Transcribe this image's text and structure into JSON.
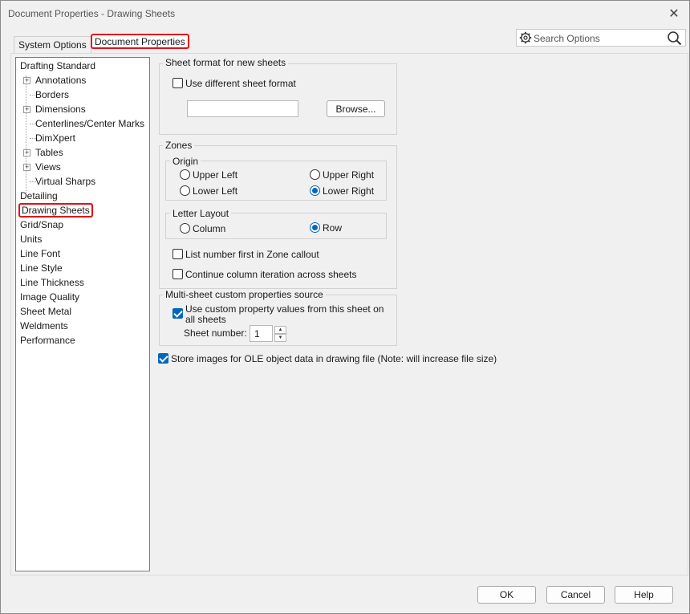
{
  "window": {
    "title": "Document Properties - Drawing Sheets"
  },
  "tabs": {
    "system": "System Options",
    "document": "Document Properties"
  },
  "search": {
    "placeholder": "Search Options"
  },
  "tree": {
    "items": [
      {
        "label": "Drafting Standard"
      },
      {
        "label": "Annotations"
      },
      {
        "label": "Borders"
      },
      {
        "label": "Dimensions"
      },
      {
        "label": "Centerlines/Center Marks"
      },
      {
        "label": "DimXpert"
      },
      {
        "label": "Tables"
      },
      {
        "label": "Views"
      },
      {
        "label": "Virtual Sharps"
      },
      {
        "label": "Detailing"
      },
      {
        "label": "Drawing Sheets"
      },
      {
        "label": "Grid/Snap"
      },
      {
        "label": "Units"
      },
      {
        "label": "Line Font"
      },
      {
        "label": "Line Style"
      },
      {
        "label": "Line Thickness"
      },
      {
        "label": "Image Quality"
      },
      {
        "label": "Sheet Metal"
      },
      {
        "label": "Weldments"
      },
      {
        "label": "Performance"
      }
    ],
    "selected": "Drawing Sheets"
  },
  "sheet_format": {
    "title": "Sheet format for new sheets",
    "use_different_label": "Use different sheet format",
    "use_different_checked": false,
    "path_value": "",
    "browse_label": "Browse..."
  },
  "zones": {
    "title": "Zones",
    "origin": {
      "title": "Origin",
      "upper_left": "Upper Left",
      "upper_right": "Upper Right",
      "lower_left": "Lower Left",
      "lower_right": "Lower Right",
      "selected": "Lower Right"
    },
    "letter_layout": {
      "title": "Letter Layout",
      "column": "Column",
      "row": "Row",
      "selected": "Row"
    },
    "list_number_first": "List number first in Zone callout",
    "list_number_first_checked": false,
    "continue_iteration": "Continue column iteration across sheets",
    "continue_iteration_checked": false
  },
  "multi_sheet": {
    "title": "Multi-sheet custom properties source",
    "use_custom_line1": "Use custom property values from this sheet on",
    "use_custom_line2": "all sheets",
    "use_custom_checked": true,
    "sheet_number_label": "Sheet number:",
    "sheet_number_value": "1"
  },
  "store_images": {
    "label": "Store images for OLE object data in drawing file (Note: will increase file size)",
    "checked": true
  },
  "footer": {
    "ok": "OK",
    "cancel": "Cancel",
    "help": "Help"
  },
  "colors": {
    "accent": "#0067c0",
    "highlight": "#e0101a"
  }
}
